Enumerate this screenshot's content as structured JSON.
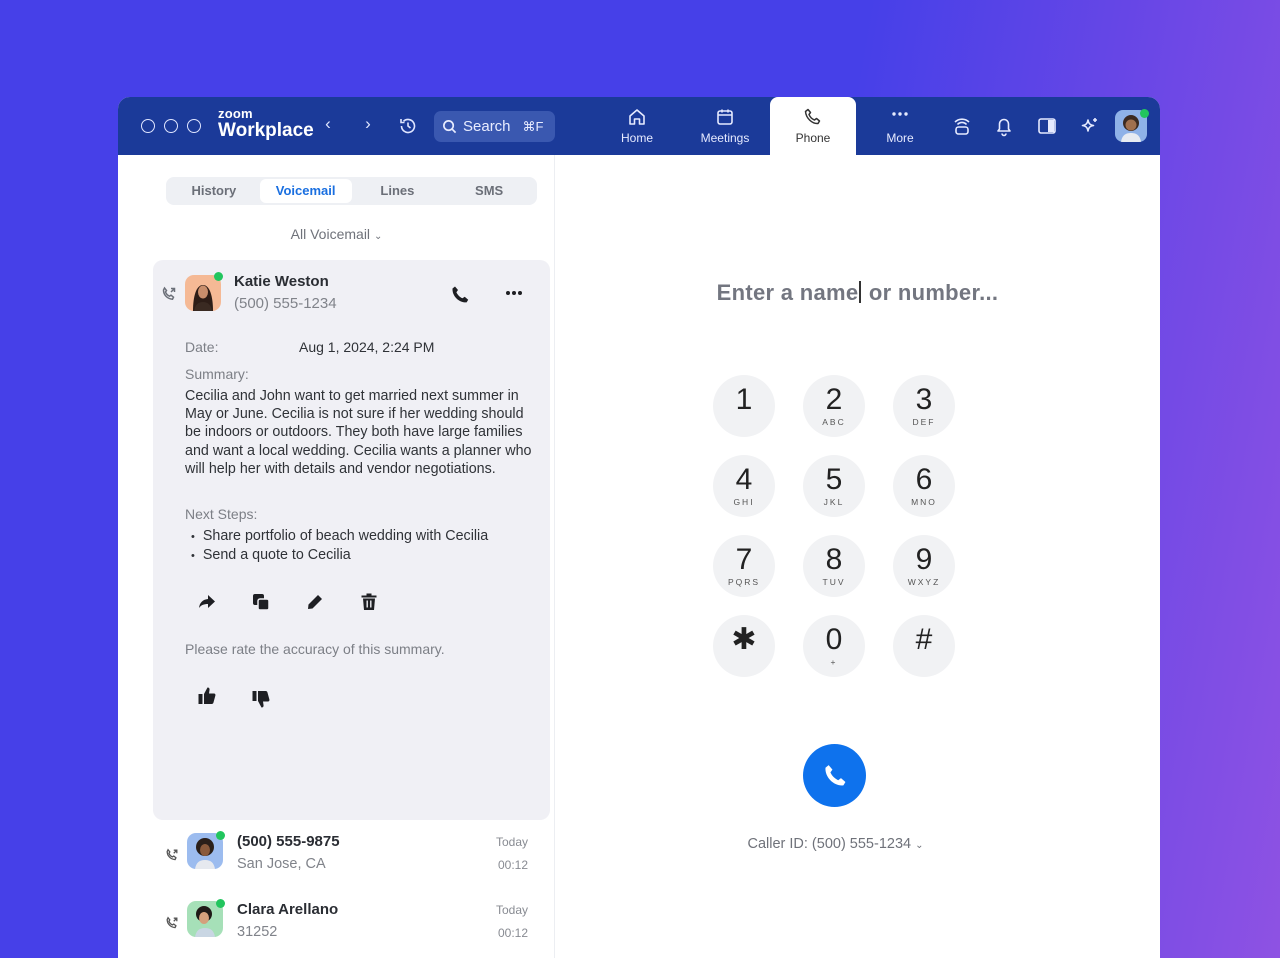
{
  "app": {
    "brand_small": "zoom",
    "brand_name": "Workplace",
    "search": {
      "label": "Search",
      "shortcut": "⌘F"
    }
  },
  "top_nav": {
    "tabs": [
      {
        "label": "Home",
        "icon": "home-icon",
        "active": false
      },
      {
        "label": "Meetings",
        "icon": "calendar-icon",
        "active": false
      },
      {
        "label": "Phone",
        "icon": "phone-icon",
        "active": true
      },
      {
        "label": "More",
        "icon": "more-dots-icon",
        "active": false
      }
    ],
    "right_icons": [
      "presence-device-icon",
      "bell-icon",
      "panel-toggle-icon",
      "ai-sparkle-icon"
    ],
    "user_status": "online"
  },
  "phone": {
    "segments": [
      "History",
      "Voicemail",
      "Lines",
      "SMS"
    ],
    "active_segment": "Voicemail",
    "filter": "All Voicemail",
    "selected_voicemail": {
      "name": "Katie Weston",
      "number": "(500) 555-1234",
      "date_label": "Date:",
      "date_value": "Aug 1, 2024, 2:24 PM",
      "summary_label": "Summary:",
      "summary": "Cecilia and John want to get married next summer in May or June. Cecilia is not sure if her wedding should be indoors or outdoors. They both have large families and want a local wedding. Cecilia wants a planner who will help her with details and vendor negotiations.",
      "next_steps_label": "Next Steps:",
      "next_steps": [
        "Share portfolio of beach wedding with Cecilia",
        "Send a quote to Cecilia"
      ],
      "actions": [
        "share",
        "copy",
        "edit",
        "delete"
      ],
      "rate_prompt": "Please rate the accuracy of this summary."
    },
    "voicemails": [
      {
        "title": "(500) 555-9875",
        "subtitle": "San Jose, CA",
        "date": "Today",
        "duration": "00:12"
      },
      {
        "title": "Clara Arellano",
        "subtitle": "31252",
        "date": "Today",
        "duration": "00:12"
      }
    ],
    "dialer": {
      "placeholder_before_caret": "Enter a name",
      "placeholder_after_caret": " or number...",
      "keys": [
        {
          "digit": "1",
          "letters": ""
        },
        {
          "digit": "2",
          "letters": "ABC"
        },
        {
          "digit": "3",
          "letters": "DEF"
        },
        {
          "digit": "4",
          "letters": "GHI"
        },
        {
          "digit": "5",
          "letters": "JKL"
        },
        {
          "digit": "6",
          "letters": "MNO"
        },
        {
          "digit": "7",
          "letters": "PQRS"
        },
        {
          "digit": "8",
          "letters": "TUV"
        },
        {
          "digit": "9",
          "letters": "WXYZ"
        },
        {
          "digit": "✱",
          "letters": ""
        },
        {
          "digit": "0",
          "letters": "+"
        },
        {
          "digit": "#",
          "letters": ""
        }
      ],
      "caller_id": "Caller ID: (500) 555-1234"
    }
  }
}
